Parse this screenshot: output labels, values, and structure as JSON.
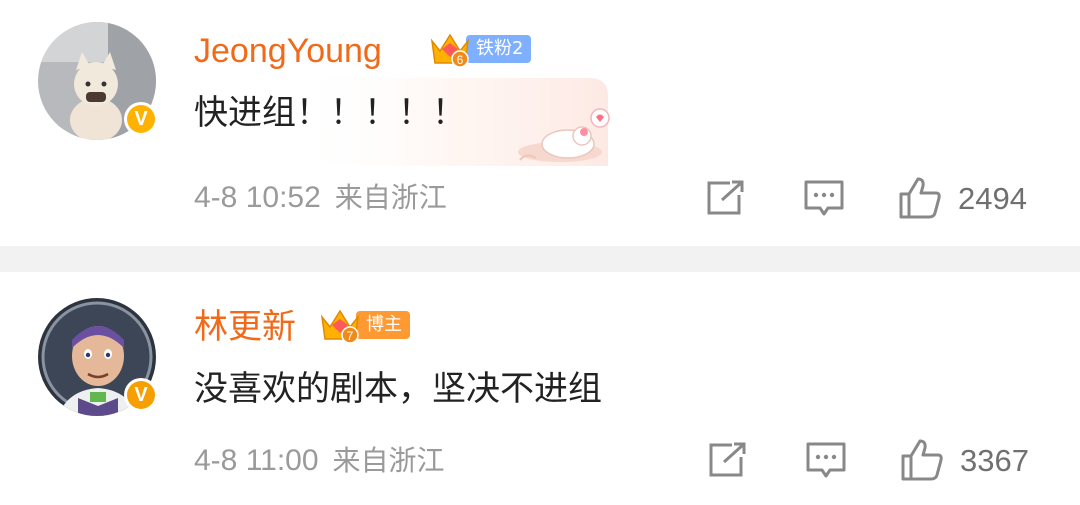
{
  "comments": [
    {
      "username": "JeongYoung",
      "badge_label": "铁粉2",
      "badge_level": "6",
      "verified": "V",
      "text": "快进组！！！！！",
      "time": "4-8 10:52",
      "location": "来自浙江",
      "likes": "2494",
      "colors": {
        "name": "#f06a1a",
        "badge_bg": "#7fb0ff",
        "verified": "#ffb300"
      }
    },
    {
      "username": "林更新",
      "badge_label": "博主",
      "badge_level": "7",
      "verified": "V",
      "text": "没喜欢的剧本，坚决不进组",
      "time": "4-8 11:00",
      "location": "来自浙江",
      "likes": "3367",
      "colors": {
        "name": "#f06a1a",
        "badge_bg": "#ff9a33",
        "verified": "#f5a000"
      }
    }
  ],
  "icons": {
    "repost": "share-icon",
    "comment": "comment-icon",
    "like": "thumbs-up-icon",
    "crown": "crown-icon"
  }
}
